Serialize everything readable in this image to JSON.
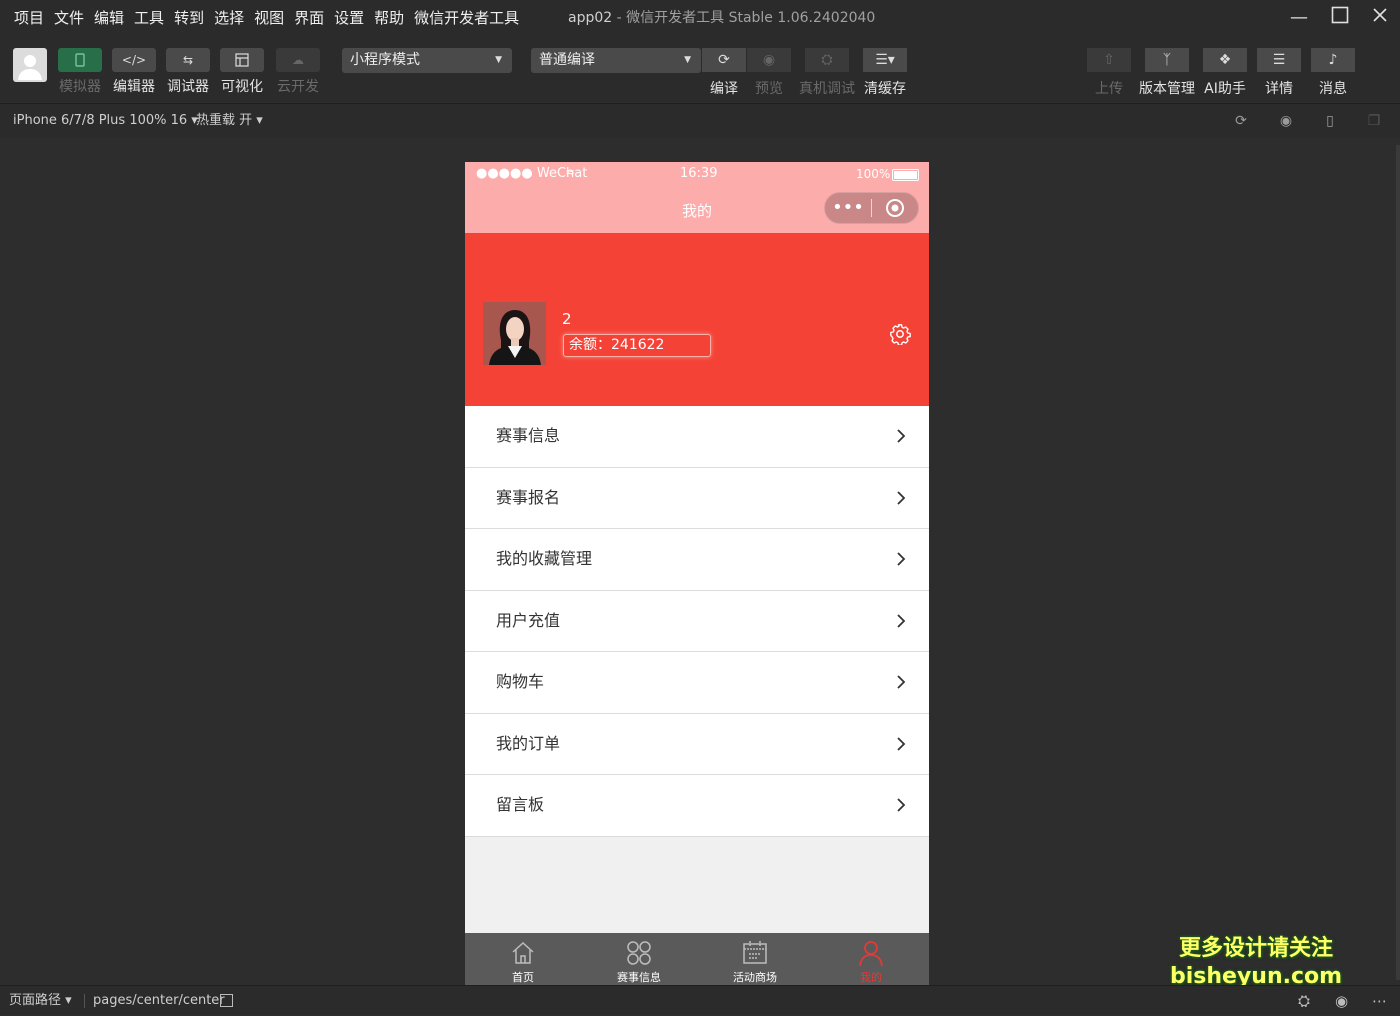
{
  "menubar": {
    "items": [
      "项目",
      "文件",
      "编辑",
      "工具",
      "转到",
      "选择",
      "视图",
      "界面",
      "设置",
      "帮助",
      "微信开发者工具"
    ],
    "app_name": "app02",
    "window_title": "- 微信开发者工具 Stable 1.06.2402040"
  },
  "toolbar": {
    "left_tools": [
      {
        "label": "模拟器",
        "icon": "phone-icon"
      },
      {
        "label": "编辑器",
        "icon": "code-icon"
      },
      {
        "label": "调试器",
        "icon": "debug-icon"
      },
      {
        "label": "可视化",
        "icon": "layout-icon"
      },
      {
        "label": "云开发",
        "icon": "cloud-icon"
      }
    ],
    "mode_select": "小程序模式",
    "compile_select": "普通编译",
    "center_tools": [
      {
        "label": "编译",
        "icon": "refresh-icon"
      },
      {
        "label": "预览",
        "icon": "eye-icon"
      },
      {
        "label": "真机调试",
        "icon": "bug-icon"
      },
      {
        "label": "清缓存",
        "icon": "layers-icon"
      }
    ],
    "right_tools": [
      {
        "label": "上传",
        "icon": "upload-icon"
      },
      {
        "label": "版本管理",
        "icon": "branch-icon"
      },
      {
        "label": "AI助手",
        "icon": "ai-icon"
      },
      {
        "label": "详情",
        "icon": "menu-icon"
      },
      {
        "label": "消息",
        "icon": "bell-icon"
      }
    ]
  },
  "devbar": {
    "device": "iPhone 6/7/8 Plus 100% 16 ▾",
    "hotreload": "热重载 开 ▾"
  },
  "phone": {
    "status": {
      "signal": "●●●●● WeChat",
      "time": "16:39",
      "battery": "100%"
    },
    "nav_title": "我的",
    "user": {
      "name": "2",
      "balance": "余额：241622"
    },
    "menu": [
      "赛事信息",
      "赛事报名",
      "我的收藏管理",
      "用户充值",
      "购物车",
      "我的订单",
      "留言板"
    ],
    "tabs": [
      {
        "label": "首页",
        "icon": "home-icon"
      },
      {
        "label": "赛事信息",
        "icon": "grid-icon"
      },
      {
        "label": "活动商场",
        "icon": "calendar-icon"
      },
      {
        "label": "我的",
        "icon": "user-icon"
      }
    ]
  },
  "footer": {
    "path_label": "页面路径 ▾",
    "path": "pages/center/center"
  },
  "watermark": {
    "line1": "更多设计请关注",
    "line2": "bisheyun.com"
  },
  "colors": {
    "header": "#f44336",
    "nav": "#fcacaa",
    "active_tab": "#e53935",
    "green_tool": "#276e49"
  }
}
